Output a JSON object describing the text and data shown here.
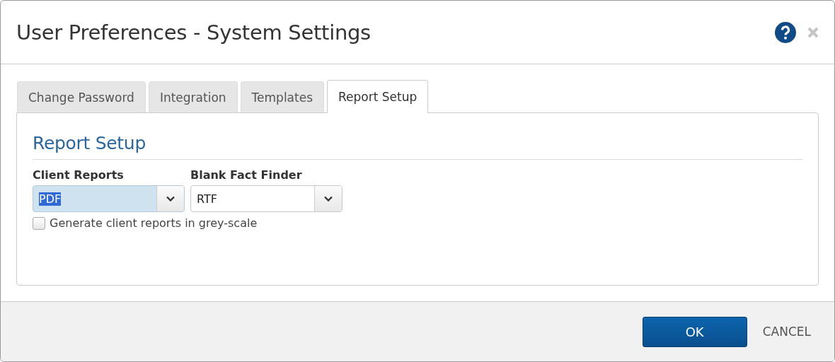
{
  "window": {
    "title": "User Preferences - System Settings"
  },
  "tabs": [
    {
      "label": "Change Password",
      "selected": false
    },
    {
      "label": "Integration",
      "selected": false
    },
    {
      "label": "Templates",
      "selected": false
    },
    {
      "label": "Report Setup",
      "selected": true
    }
  ],
  "section": {
    "heading": "Report Setup"
  },
  "dropdowns": [
    {
      "label": "Client Reports",
      "value": "PDF",
      "focused": true
    },
    {
      "label": "Blank Fact Finder",
      "value": "RTF",
      "focused": false
    }
  ],
  "checkbox": {
    "label": "Generate client reports in grey-scale",
    "checked": false
  },
  "buttons": [
    {
      "label": "OK",
      "kind": "primary"
    },
    {
      "label": "CANCEL",
      "kind": "link"
    }
  ]
}
